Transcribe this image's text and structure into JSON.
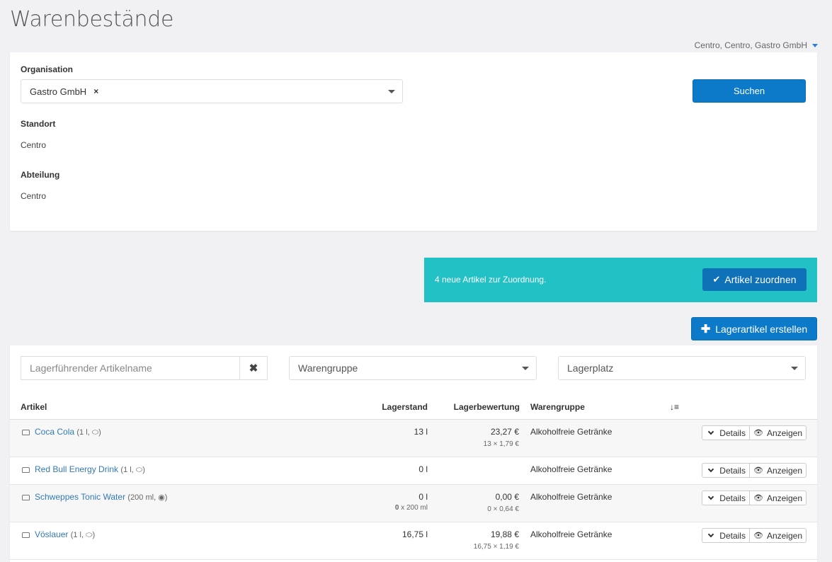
{
  "page": {
    "title": "Warenbestände"
  },
  "org_switch": {
    "label": "Centro, Centro, Gastro GmbH"
  },
  "filters": {
    "organisation_label": "Organisation",
    "organisation_value": "Gastro GmbH",
    "organisation_remove": "×",
    "standort_label": "Standort",
    "standort_value": "Centro",
    "abteilung_label": "Abteilung",
    "abteilung_value": "Centro",
    "search_button": "Suchen"
  },
  "alert": {
    "text": "4 neue Artikel zur Zuordnung.",
    "button": "Artikel zuordnen",
    "color": "#22c1c5"
  },
  "create_button": "Lagerartikel erstellen",
  "table_filters": {
    "name_placeholder": "Lagerführender Artikelname",
    "warengruppe_placeholder": "Warengruppe",
    "lagerplatz_placeholder": "Lagerplatz"
  },
  "table": {
    "headers": {
      "artikel": "Artikel",
      "lagerstand": "Lagerstand",
      "lagerbewertung": "Lagerbewertung",
      "warengruppe": "Warengruppe"
    },
    "details_label": "Details",
    "view_label": "Anzeigen",
    "rows": [
      {
        "name": "Coca Cola",
        "meta": "(1 l, ⬭)",
        "lagerstand": "13 l",
        "lagerstand_sub": "",
        "lagerstand_sub_bold": "",
        "bewertung": "23,27 €",
        "bewertung_sub": "13 × 1,79 €",
        "warengruppe": "Alkoholfreie Getränke"
      },
      {
        "name": "Red Bull Energy Drink",
        "meta": "(1 l, ⬭)",
        "lagerstand": "0 l",
        "lagerstand_sub": "",
        "lagerstand_sub_bold": "",
        "bewertung": "",
        "bewertung_sub": "",
        "warengruppe": "Alkoholfreie Getränke"
      },
      {
        "name": "Schweppes Tonic Water",
        "meta": "(200 ml, ◉)",
        "lagerstand": "0 l",
        "lagerstand_sub": " x 200 ml",
        "lagerstand_sub_bold": "0",
        "bewertung": "0,00 €",
        "bewertung_sub": "0 × 0,64 €",
        "warengruppe": "Alkoholfreie Getränke"
      },
      {
        "name": "Vöslauer",
        "meta": "(1 l, ⬭)",
        "lagerstand": "16,75 l",
        "lagerstand_sub": "",
        "lagerstand_sub_bold": "",
        "bewertung": "19,88 €",
        "bewertung_sub": "16,75 × 1,19 €",
        "warengruppe": "Alkoholfreie Getränke"
      }
    ]
  },
  "colors": {
    "primary": "#0c7ac9",
    "link": "#337ab7",
    "background": "#f1f1f4"
  }
}
